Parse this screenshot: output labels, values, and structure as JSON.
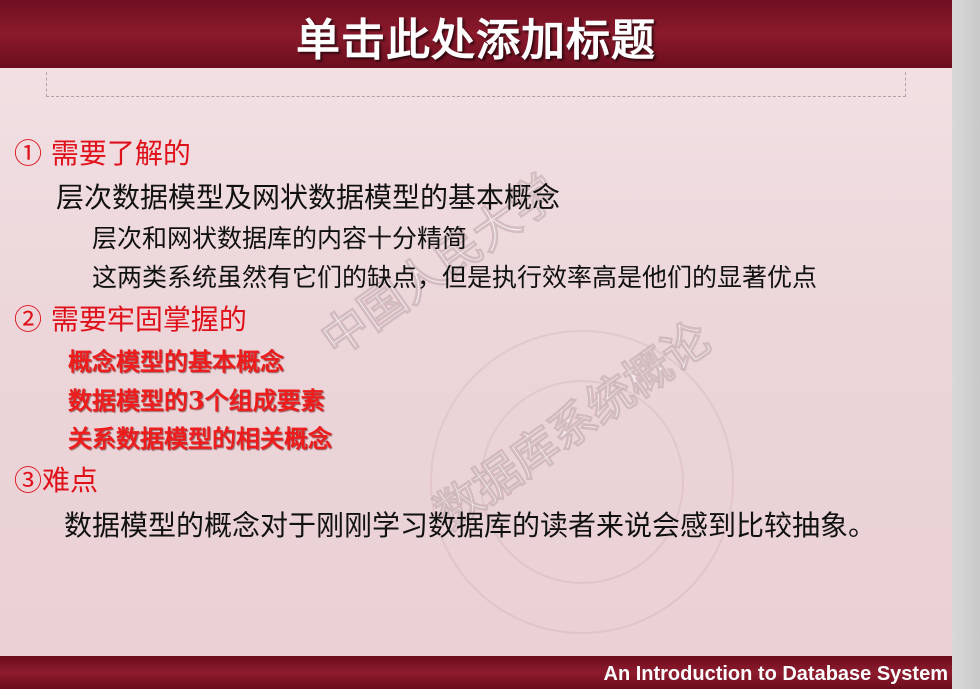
{
  "slide": {
    "title": "单击此处添加标题",
    "sections": [
      {
        "heading": "① 需要了解的",
        "items": [
          {
            "text": "层次数据模型及网状数据模型的基本概念",
            "subitems": [
              "层次和网状数据库的内容十分精简",
              "这两类系统虽然有它们的缺点，但是执行效率高是他们的显著优点"
            ]
          }
        ]
      },
      {
        "heading": "② 需要牢固掌握的",
        "items": [
          "概念模型的基本概念",
          "数据模型的3个组成要素",
          "关系数据模型的相关概念"
        ]
      },
      {
        "heading": "③难点",
        "items": [
          "数据模型的概念对于刚刚学习数据库的读者来说会感到比较抽象。"
        ]
      }
    ],
    "watermark": {
      "line1": "中国人民大学",
      "line2": "数据库系统概论"
    },
    "footer": "An Introduction to Database System"
  },
  "colors": {
    "header": "#7a1424",
    "heading": "#e0101a",
    "emphasis": "#ee1c1c",
    "body": "#111111"
  }
}
